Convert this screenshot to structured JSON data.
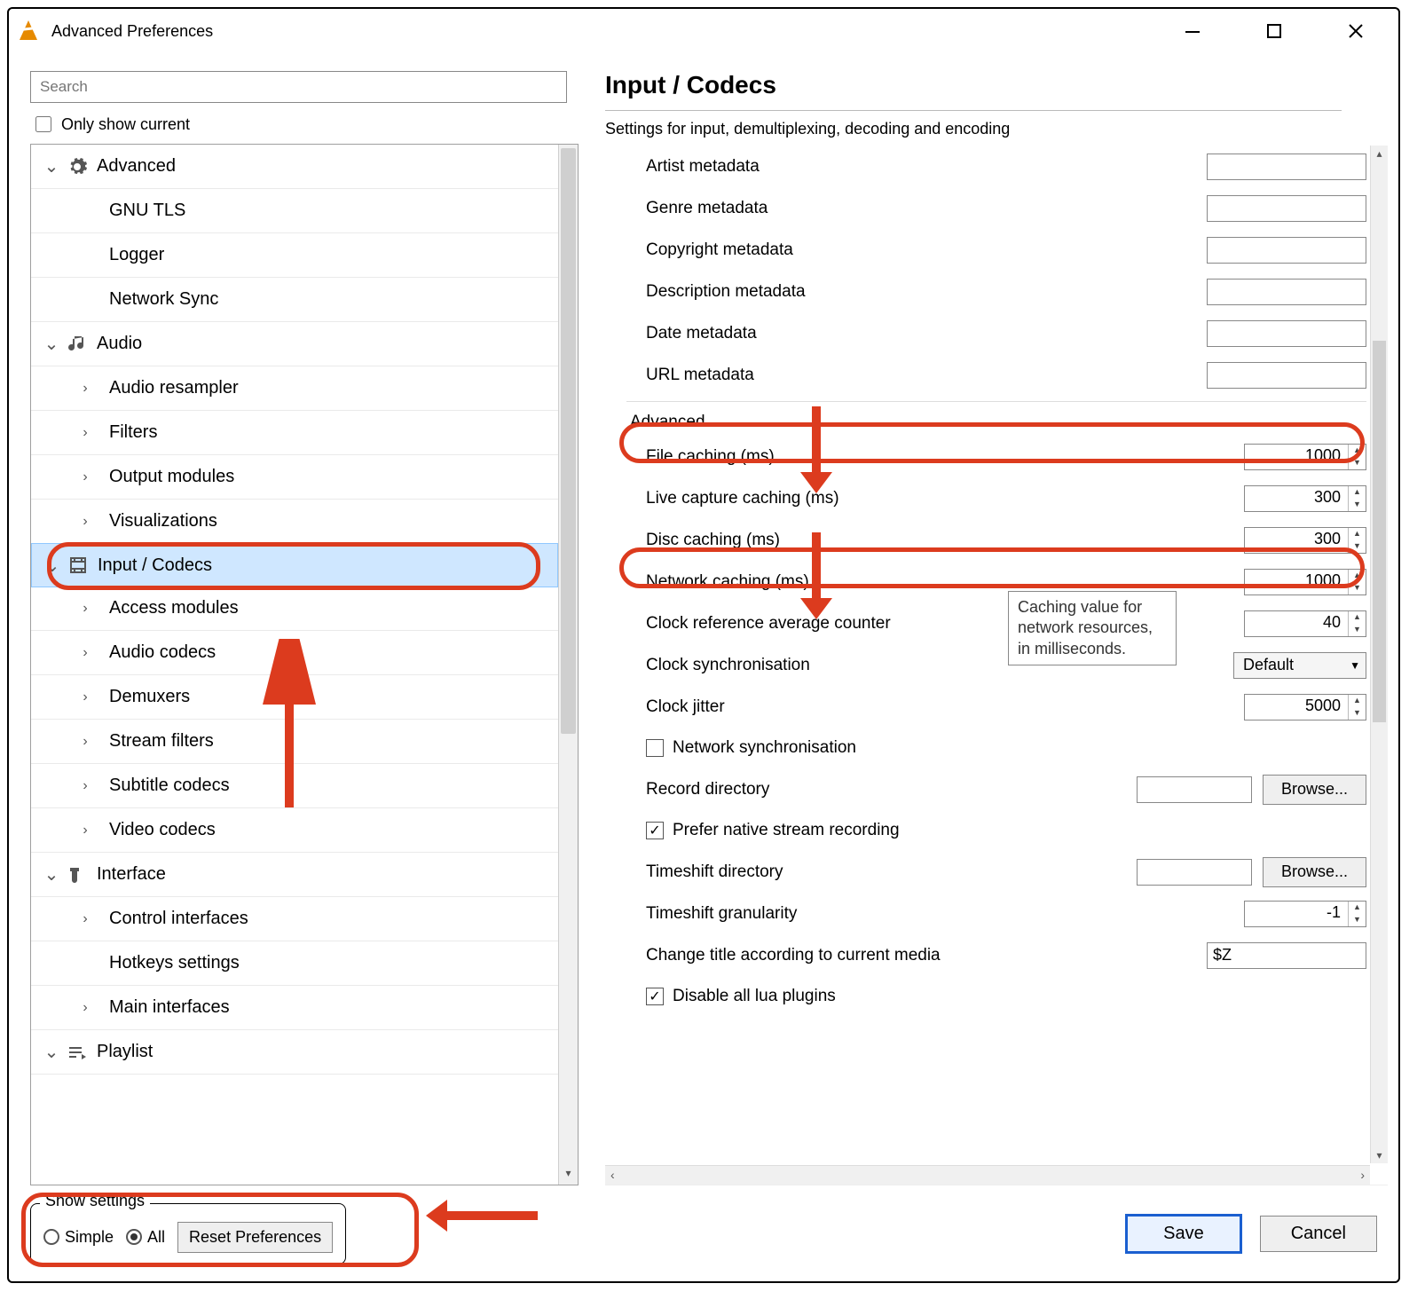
{
  "window": {
    "title": "Advanced Preferences"
  },
  "left": {
    "search_placeholder": "Search",
    "only_show_label": "Only show current",
    "only_show_checked": false,
    "tree": [
      {
        "type": "cat",
        "icon": "gear",
        "label": "Advanced",
        "expanded": true
      },
      {
        "type": "sub",
        "label": "GNU TLS",
        "has_children": false
      },
      {
        "type": "sub",
        "label": "Logger",
        "has_children": false
      },
      {
        "type": "sub",
        "label": "Network Sync",
        "has_children": false
      },
      {
        "type": "cat",
        "icon": "music",
        "label": "Audio",
        "expanded": true
      },
      {
        "type": "sub",
        "label": "Audio resampler",
        "has_children": true
      },
      {
        "type": "sub",
        "label": "Filters",
        "has_children": true
      },
      {
        "type": "sub",
        "label": "Output modules",
        "has_children": true
      },
      {
        "type": "sub",
        "label": "Visualizations",
        "has_children": true
      },
      {
        "type": "cat",
        "icon": "film",
        "label": "Input / Codecs",
        "expanded": true,
        "selected": true
      },
      {
        "type": "sub",
        "label": "Access modules",
        "has_children": true
      },
      {
        "type": "sub",
        "label": "Audio codecs",
        "has_children": true
      },
      {
        "type": "sub",
        "label": "Demuxers",
        "has_children": true
      },
      {
        "type": "sub",
        "label": "Stream filters",
        "has_children": true
      },
      {
        "type": "sub",
        "label": "Subtitle codecs",
        "has_children": true
      },
      {
        "type": "sub",
        "label": "Video codecs",
        "has_children": true
      },
      {
        "type": "cat",
        "icon": "brush",
        "label": "Interface",
        "expanded": true
      },
      {
        "type": "sub",
        "label": "Control interfaces",
        "has_children": true
      },
      {
        "type": "sub",
        "label": "Hotkeys settings",
        "has_children": false
      },
      {
        "type": "sub",
        "label": "Main interfaces",
        "has_children": true
      },
      {
        "type": "cat",
        "icon": "playlist",
        "label": "Playlist",
        "expanded": true
      }
    ]
  },
  "right": {
    "title": "Input / Codecs",
    "subtitle": "Settings for input, demultiplexing, decoding and encoding",
    "meta_text_rows": [
      "Artist metadata",
      "Genre metadata",
      "Copyright metadata",
      "Description metadata",
      "Date metadata",
      "URL metadata"
    ],
    "advanced_section": "Advanced",
    "spin_rows": [
      {
        "label": "File caching (ms)",
        "value": "1000",
        "highlight": true
      },
      {
        "label": "Live capture caching (ms)",
        "value": "300"
      },
      {
        "label": "Disc caching (ms)",
        "value": "300"
      },
      {
        "label": "Network caching (ms)",
        "value": "1000",
        "highlight": true
      },
      {
        "label": "Clock reference average counter",
        "value": "40"
      }
    ],
    "clock_sync_label": "Clock synchronisation",
    "clock_sync_value": "Default",
    "clock_jitter_label": "Clock jitter",
    "clock_jitter_value": "5000",
    "net_sync_label": "Network synchronisation",
    "net_sync_checked": false,
    "record_dir_label": "Record directory",
    "record_dir_value": "",
    "browse_label": "Browse...",
    "prefer_native_label": "Prefer native stream recording",
    "prefer_native_checked": true,
    "timeshift_dir_label": "Timeshift directory",
    "timeshift_dir_value": "",
    "timeshift_gran_label": "Timeshift granularity",
    "timeshift_gran_value": "-1",
    "change_title_label": "Change title according to current media",
    "change_title_value": "$Z",
    "disable_lua_label": "Disable all lua plugins",
    "disable_lua_checked": true,
    "tooltip_text": "Caching value for network resources, in milliseconds."
  },
  "footer": {
    "group_label": "Show settings",
    "simple_label": "Simple",
    "all_label": "All",
    "selected": "all",
    "reset_label": "Reset Preferences",
    "save_label": "Save",
    "cancel_label": "Cancel"
  }
}
